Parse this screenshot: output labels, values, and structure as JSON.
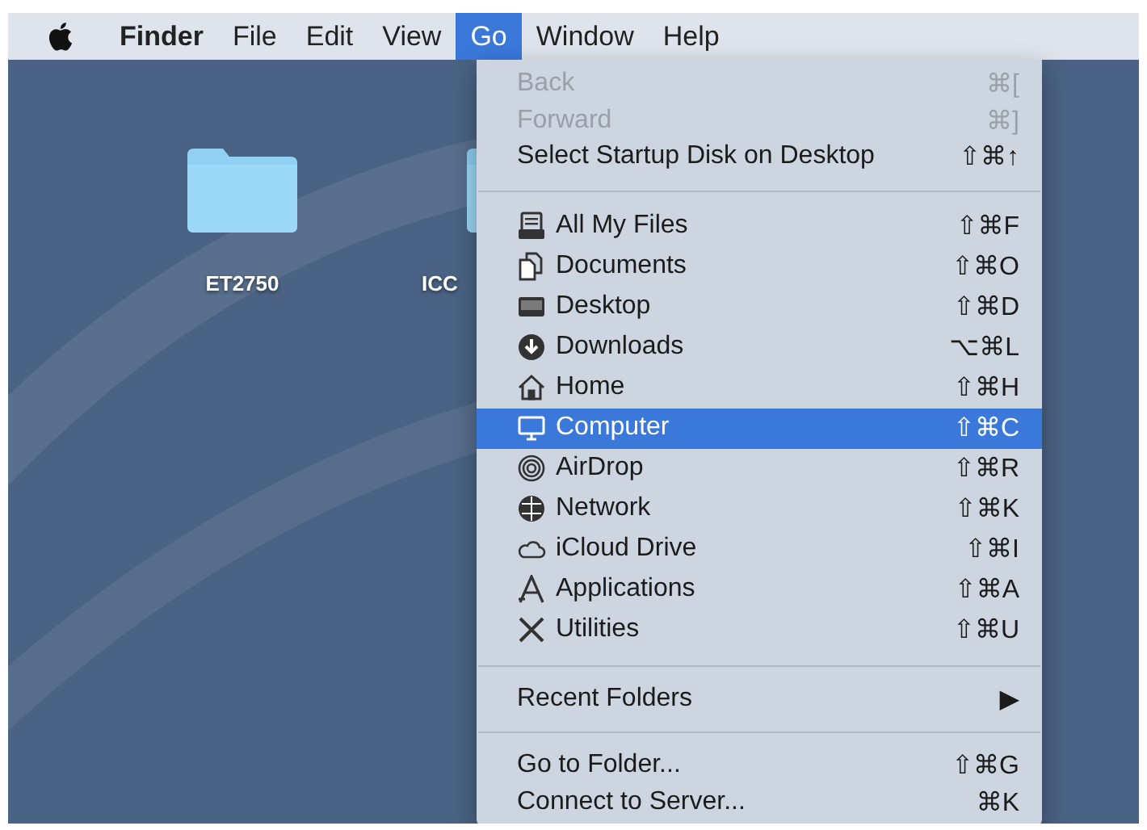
{
  "menu_bar": {
    "items": [
      {
        "label": "Finder",
        "selected": false,
        "bold": true
      },
      {
        "label": "File",
        "selected": false,
        "bold": false
      },
      {
        "label": "Edit",
        "selected": false,
        "bold": false
      },
      {
        "label": "View",
        "selected": false,
        "bold": false
      },
      {
        "label": "Go",
        "selected": true,
        "bold": false
      },
      {
        "label": "Window",
        "selected": false,
        "bold": false
      },
      {
        "label": "Help",
        "selected": false,
        "bold": false
      }
    ]
  },
  "desktop": {
    "icons": [
      {
        "label": "ET2750"
      },
      {
        "label": "ICC"
      }
    ]
  },
  "go_menu": {
    "sections": [
      {
        "compact": true,
        "items": [
          {
            "label": "Back",
            "shortcut": "⌘[",
            "disabled": true,
            "selected": false
          },
          {
            "label": "Forward",
            "shortcut": "⌘]",
            "disabled": true,
            "selected": false
          },
          {
            "label": "Select Startup Disk on Desktop",
            "shortcut": "⇧⌘↑",
            "disabled": false,
            "selected": false
          }
        ]
      },
      {
        "compact": false,
        "items": [
          {
            "label": "All My Files",
            "shortcut": "⇧⌘F",
            "disabled": false,
            "selected": false,
            "kind": "files"
          },
          {
            "label": "Documents",
            "shortcut": "⇧⌘O",
            "disabled": false,
            "selected": false,
            "kind": "documents"
          },
          {
            "label": "Desktop",
            "shortcut": "⇧⌘D",
            "disabled": false,
            "selected": false,
            "kind": "desktop"
          },
          {
            "label": "Downloads",
            "shortcut": "⌥⌘L",
            "disabled": false,
            "selected": false,
            "kind": "downloads"
          },
          {
            "label": "Home",
            "shortcut": "⇧⌘H",
            "disabled": false,
            "selected": false,
            "kind": "home"
          },
          {
            "label": "Computer",
            "shortcut": "⇧⌘C",
            "disabled": false,
            "selected": true,
            "kind": "computer"
          },
          {
            "label": "AirDrop",
            "shortcut": "⇧⌘R",
            "disabled": false,
            "selected": false,
            "kind": "airdrop"
          },
          {
            "label": "Network",
            "shortcut": "⇧⌘K",
            "disabled": false,
            "selected": false,
            "kind": "network"
          },
          {
            "label": "iCloud Drive",
            "shortcut": "⇧⌘I",
            "disabled": false,
            "selected": false,
            "kind": "cloud"
          },
          {
            "label": "Applications",
            "shortcut": "⇧⌘A",
            "disabled": false,
            "selected": false,
            "kind": "applications"
          },
          {
            "label": "Utilities",
            "shortcut": "⇧⌘U",
            "disabled": false,
            "selected": false,
            "kind": "utilities"
          }
        ]
      },
      {
        "compact": true,
        "items": [
          {
            "label": "Recent Folders",
            "shortcut": "▶",
            "disabled": false,
            "selected": false
          }
        ]
      },
      {
        "compact": true,
        "items": [
          {
            "label": "Go to Folder...",
            "shortcut": "⇧⌘G",
            "disabled": false,
            "selected": false
          },
          {
            "label": "Connect to Server...",
            "shortcut": "⌘K",
            "disabled": false,
            "selected": false
          }
        ]
      }
    ]
  }
}
